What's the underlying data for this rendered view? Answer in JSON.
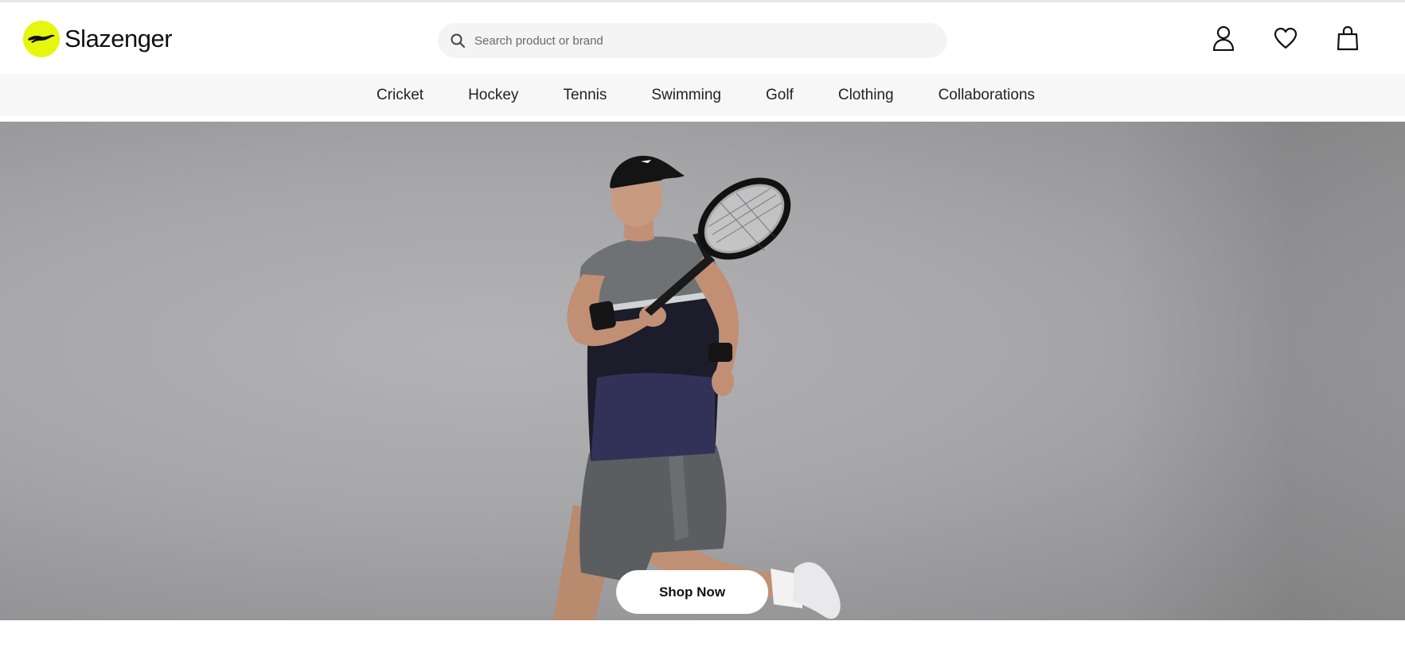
{
  "brand": {
    "name": "Slazenger",
    "logo_icon": "panther-logo-icon",
    "accent_color": "#e5f70c"
  },
  "search": {
    "placeholder": "Search product or brand",
    "icon": "search-icon"
  },
  "header_icons": [
    {
      "name": "account-icon"
    },
    {
      "name": "wishlist-heart-icon"
    },
    {
      "name": "shopping-bag-icon"
    }
  ],
  "nav": {
    "items": [
      {
        "label": "Cricket"
      },
      {
        "label": "Hockey"
      },
      {
        "label": "Tennis"
      },
      {
        "label": "Swimming"
      },
      {
        "label": "Golf"
      },
      {
        "label": "Clothing"
      },
      {
        "label": "Collaborations"
      }
    ]
  },
  "hero": {
    "cta_label": "Shop Now",
    "image": "tennis-player-photo"
  }
}
